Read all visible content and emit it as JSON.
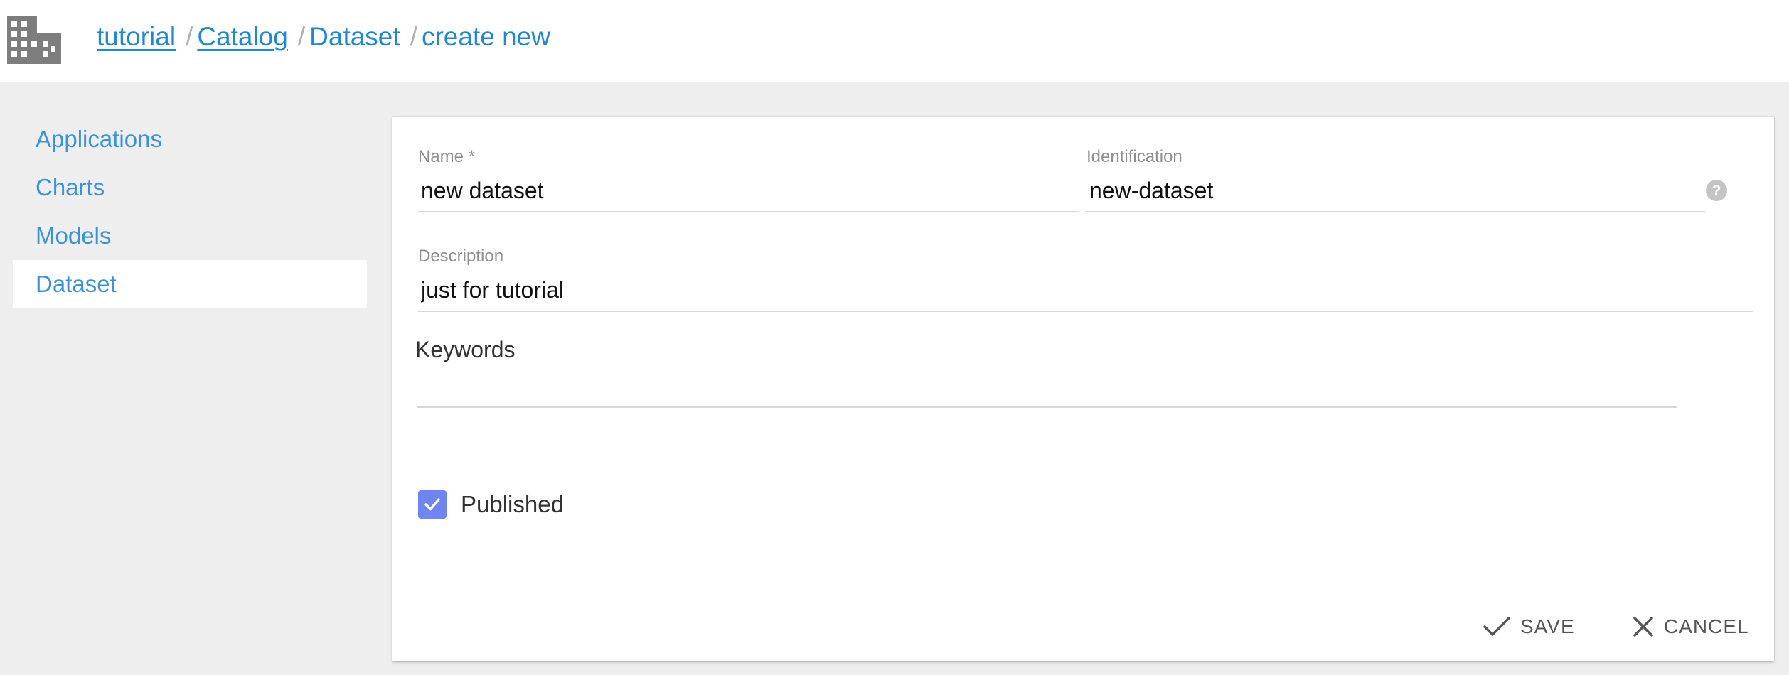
{
  "header": {
    "icon": "building-icon",
    "breadcrumb": {
      "items": [
        {
          "label": "tutorial",
          "link": true
        },
        {
          "label": "Catalog",
          "link": true
        },
        {
          "label": "Dataset",
          "link": false
        },
        {
          "label": "create new",
          "link": false
        }
      ],
      "separator": "/"
    }
  },
  "sidebar": {
    "items": [
      {
        "label": "Applications",
        "active": false
      },
      {
        "label": "Charts",
        "active": false
      },
      {
        "label": "Models",
        "active": false
      },
      {
        "label": "Dataset",
        "active": true
      }
    ]
  },
  "form": {
    "name": {
      "label": "Name *",
      "value": "new dataset"
    },
    "identification": {
      "label": "Identification",
      "value": "new-dataset",
      "help_icon": "help-circle-icon"
    },
    "description": {
      "label": "Description",
      "value": "just for tutorial"
    },
    "keywords": {
      "label": "Keywords",
      "value": ""
    },
    "published": {
      "label": "Published",
      "checked": true
    },
    "save_label": "SAVE",
    "cancel_label": "CANCEL"
  },
  "colors": {
    "link": "#1f87d6",
    "nav_text": "#3a92d8",
    "checkbox": "#6f86f0",
    "page_bg": "#eeeeee"
  }
}
